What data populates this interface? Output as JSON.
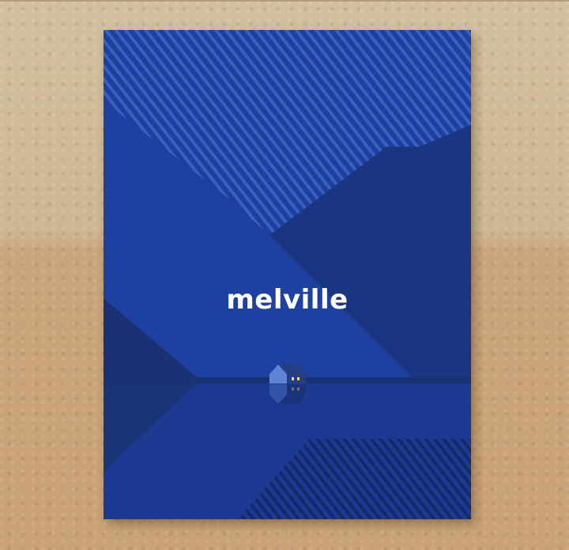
{
  "poster": {
    "brand": "melville",
    "colors": {
      "background": "#1e3f9b",
      "mountain_dark": "#1b3680",
      "mountain_shadow": "#1a3274",
      "stripe": "#3a5fc2",
      "water": "#1c3a92",
      "house_wall": "#5f84d6",
      "house_roof": "#243e80",
      "window_light": "#f4d46b",
      "logo": "#ffffff"
    },
    "icons": [
      "house-icon"
    ]
  }
}
